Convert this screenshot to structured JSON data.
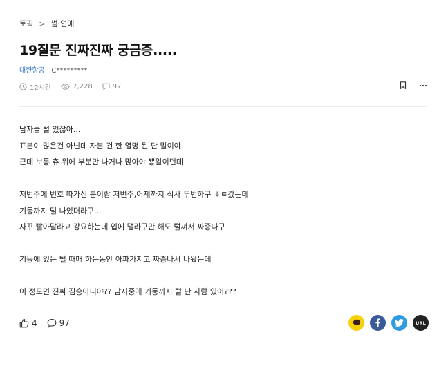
{
  "breadcrumb": {
    "root": "토픽",
    "separator": ">",
    "current": "썸·연애"
  },
  "post": {
    "title": "19질문 진짜진짜 궁금증.....",
    "company": "대한항공",
    "author": " · C*********",
    "time": "12시간",
    "views": "7,228",
    "comments": "97",
    "body": [
      "남자들 털 있잖아...",
      "표본이 많은건 아닌데 자본 건 한 열명 된 단 말이야",
      "근데 보통 츄 위에 부분만 나거나 많아야 뿅알이던데",
      "",
      "저번주에 번호 따가신 분이랑 저번주,어제까지 식사 두번하구 ㅎㅌ갔는데",
      "기둥까지 털 나있더라구...",
      "자꾸 빨아달라고 강요하는데 입에 댈라구만 해도 털껴서 짜증나구",
      "",
      "기둥에 있는 털 때매 하는동안 아파가지고 짜증나서 나왔는데",
      "",
      "이 정도면 진짜 짐승아니야?? 남자중에 기둥까지 털 난 사람 있어???"
    ]
  },
  "footer": {
    "likes": "4",
    "comments": "97",
    "url_label": "URL"
  },
  "icons": {
    "clock": "clock-icon",
    "eye": "eye-icon",
    "comment": "comment-icon",
    "bookmark": "bookmark-icon",
    "more": "more-icon",
    "like": "thumbs-up-icon"
  },
  "colors": {
    "company": "#3d79c7",
    "kakao": "#f6d10a",
    "facebook": "#3a5a98",
    "twitter": "#2f9ce0",
    "url": "#222222"
  }
}
